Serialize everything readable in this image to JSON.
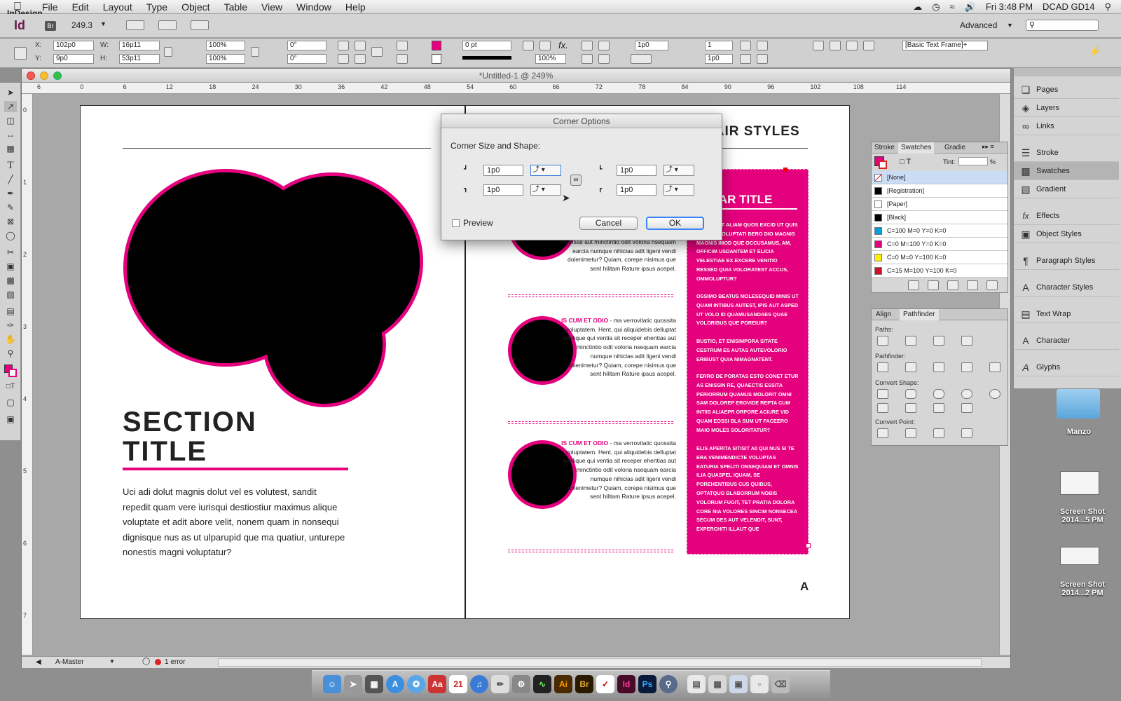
{
  "menubar": {
    "app_name": "InDesign",
    "items": [
      "File",
      "Edit",
      "Layout",
      "Type",
      "Object",
      "Table",
      "View",
      "Window",
      "Help"
    ],
    "clock": "Fri 3:48 PM",
    "user": "DCAD GD14"
  },
  "appbar": {
    "app_icon": "Id",
    "bridge_icon": "Br",
    "zoom": "249.3",
    "workspace": "Advanced"
  },
  "control": {
    "x_label": "X:",
    "x": "102p0",
    "y_label": "Y:",
    "y": "9p0",
    "w_label": "W:",
    "w": "16p11",
    "h_label": "H:",
    "h": "53p11",
    "scale_x": "100%",
    "scale_y": "100%",
    "rotate": "0°",
    "shear": "0°",
    "stroke_weight": "0 pt",
    "opacity": "100%",
    "offset": "1p0",
    "columns": "1",
    "gutter": "1p0",
    "frame_style": "[Basic Text Frame]+"
  },
  "document": {
    "title": "*Untitled-1 @ 249%",
    "ruler_ticks": [
      "6",
      "0",
      "6",
      "12",
      "18",
      "24",
      "30",
      "36",
      "42",
      "48",
      "54",
      "60",
      "66",
      "72",
      "78",
      "84",
      "90",
      "96",
      "102",
      "108",
      "114"
    ],
    "vruler_ticks": [
      "0",
      "1",
      "2",
      "3",
      "4",
      "5",
      "6",
      "7"
    ],
    "status": {
      "page": "A-Master",
      "errors": "1 error"
    }
  },
  "left_page": {
    "section_title_1": "SECTION",
    "section_title_2": "TITLE",
    "body": "Uci adi dolut magnis dolut vel es volutest, sandit repedit quam vere iurisqui destiostiur maximus alique voluptate et adit abore velit, nonem quam in nonsequi dignisque nus as ut ulparupid que ma quatiur, unturepe nonestis magni voluptatur?"
  },
  "right_page": {
    "heading": "HAIR STYLES",
    "sidebar_title": "DEBAR TITLE",
    "sidebar_paragraphs": [
      "CORAE, UT ALIAM QUOS EXCID UT QUIS COMNIS SOLUPTATI BERO DIO MAGNIS MAGNIS IMOD QUE OCCUSAMUS, AM, OFFICIM USDANTEM ET ELICIA VELESTIAE EX EXCERE VENITIO RESSED QUIA VOLORATEST ACCUS, OMMOLUPTUR?",
      "OSSIMO BEATUS MOLESEQUID MINIS UT QUAM INTIBUS AUTEST, IPIS AUT ASPED UT VOLO ID QUAMUSANDAES QUAE VOLORIBUS QUE POREIUR?",
      "BUSTIO, ET ENISIMPORA SITATE CESTRUM ES AUTAS AUTEVOLORIO ERIBUST QUIA NIMAGNATENT.",
      "FERRO DE PORATAS ESTO CONET ETUR AS ENISSIN RE, QUAECTIS ESSITA PERIORRUM QUAMUS MOLORIT OMNI SAM DOLOREP EROVIDE REPTA CUM INTIIS ALIAEPR ORPORE ACIURE VID QUAM EOSSI BLA SUM UT FACEERO MAIO MOLES SOLORITATUR?",
      "ELIS APERITA SITISIT A0 QUI NUS SI TE ERA VENIMENDICTE VOLUPTAS EATURIA SPELITI ONSEQUIAM ET OMNIS ILIA QUASPEL IQUAM, SE POREHENTIBUS CUS QUIBUS, OPTATQUO BLABORRUM NOBIS VOLORUM FUGIT, TET PRATIA DOLORA CORE NIA VOLORES SINCIM NONSECEA SECUM DES AUT VELENDIT, SUNT, EXPERCHITI ILLAUT QUE"
    ],
    "article_1_tail": "ehentias aut minctintio odit voloria nsequam earcia numque nihicias adit ligeni vendi dolenimetur? Quiam, corepe nisimus que sent hilitam Rature ipsus acepel.",
    "article_2_lead": "IS CUM ET ODIO",
    "article_2_body": " - ma verrovitatic quossita voluptatem. Hent, qui aliquidebis delluptat inihilique qui ventia sit receper ehentias aut minctintio odit voloria nsequam earcia numque nihicias adit ligeni vendi dolenimetur? Quiam, corepe nisimus que sent hilitam Rature ipsus acepel.",
    "article_3_lead": "IS CUM ET ODIO",
    "article_3_body": " - ma verrovitatic quossita voluptatem. Hent, qui aliquidebis delluptat inihilique qui ventia sit receper ehentias aut minctintio odit voloria nsequam earcia numque nihicias adit ligeni vendi dolenimetur? Quiam, corepe nisimus que sent hilitam Rature ipsus acepel.",
    "master_letter": "A"
  },
  "dialog": {
    "title": "Corner Options",
    "section": "Corner Size and Shape:",
    "top_left": "1p0",
    "top_right": "1p0",
    "bottom_left": "1p0",
    "bottom_right": "1p0",
    "preview_label": "Preview",
    "cancel": "Cancel",
    "ok": "OK"
  },
  "swatches_panel": {
    "tabs": [
      "Stroke",
      "Swatches",
      "Gradie"
    ],
    "tint_label": "Tint:",
    "tint_unit": "%",
    "swatches": [
      {
        "name": "[None]",
        "color": "#ffffff"
      },
      {
        "name": "[Registration]",
        "color": "#000000"
      },
      {
        "name": "[Paper]",
        "color": "#ffffff"
      },
      {
        "name": "[Black]",
        "color": "#000000"
      },
      {
        "name": "C=100 M=0 Y=0 K=0",
        "color": "#00a0e0"
      },
      {
        "name": "C=0 M=100 Y=0 K=0",
        "color": "#e5007d"
      },
      {
        "name": "C=0 M=0 Y=100 K=0",
        "color": "#ffee00"
      },
      {
        "name": "C=15 M=100 Y=100 K=0",
        "color": "#d0112b"
      }
    ]
  },
  "pathfinder_panel": {
    "tabs": [
      "Align",
      "Pathfinder"
    ],
    "sections": [
      "Paths:",
      "Pathfinder:",
      "Convert Shape:",
      "Convert Point:"
    ]
  },
  "dock_panels": [
    "Pages",
    "Layers",
    "Links",
    "Stroke",
    "Swatches",
    "Gradient",
    "Effects",
    "Object Styles",
    "Paragraph Styles",
    "Character Styles",
    "Text Wrap",
    "Character",
    "Glyphs"
  ],
  "desktop": {
    "folder": "Manzo",
    "shot1": "Screen Shot 2014...5 PM",
    "shot2": "Screen Shot 2014...2 PM"
  },
  "dock_apps": [
    "Ai",
    "Br",
    "Id",
    "Ps"
  ],
  "colors": {
    "magenta": "#e5007d",
    "black": "#000000"
  }
}
